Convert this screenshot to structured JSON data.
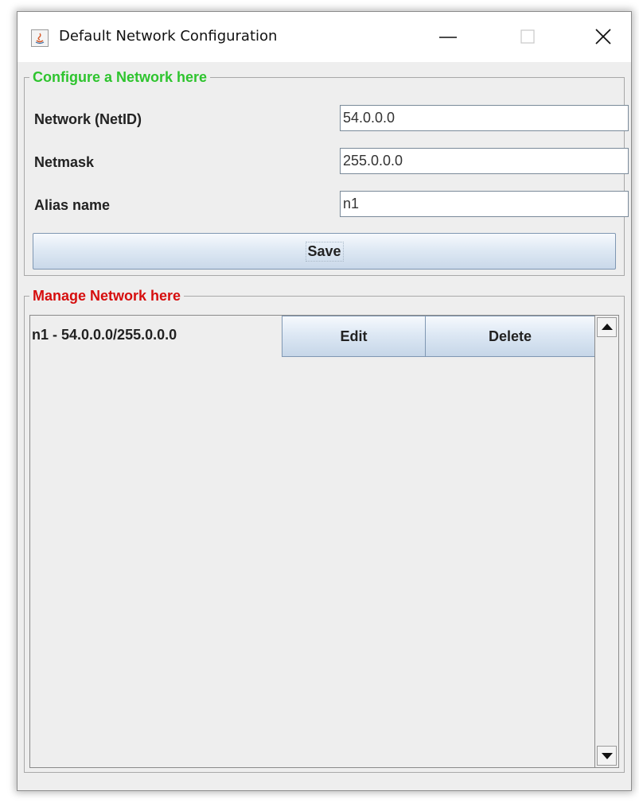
{
  "window": {
    "title": "Default Network Configuration",
    "app_icon": "java-icon"
  },
  "configure": {
    "legend": "Configure a Network here",
    "legend_color": "#2ec42e",
    "fields": [
      {
        "label": "Network (NetID)",
        "value": "54.0.0.0"
      },
      {
        "label": "Netmask",
        "value": "255.0.0.0"
      },
      {
        "label": "Alias name",
        "value": "n1"
      }
    ],
    "save_label": "Save"
  },
  "manage": {
    "legend": "Manage Network here",
    "legend_color": "#d60e0e",
    "rows": [
      {
        "text": "n1 - 54.0.0.0/255.0.0.0",
        "edit_label": "Edit",
        "delete_label": "Delete"
      }
    ]
  }
}
